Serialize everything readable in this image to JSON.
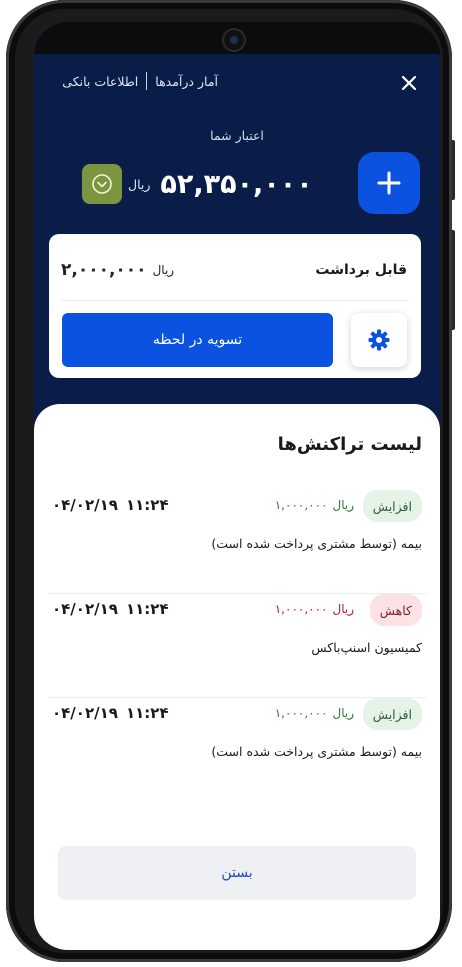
{
  "header": {
    "close_icon": "close-icon",
    "links": [
      "آمار درآمدها",
      "اطلاعات بانکی"
    ]
  },
  "balance": {
    "label": "اعتبار شما",
    "amount": "۵۲,۳۵۰,۰۰۰",
    "currency": "ریال"
  },
  "withdrawable": {
    "label": "قابل برداشت",
    "amount": "۲,۰۰۰,۰۰۰",
    "currency": "ریال",
    "settle_label": "تسویه در لحظه"
  },
  "transactions": {
    "title": "لیست تراکنش‌ها",
    "items": [
      {
        "type": "افزایش",
        "kind": "inc",
        "amount": "۱,۰۰۰,۰۰۰",
        "currency": "ریال",
        "time": "۱۱:۲۴",
        "date": "۰۴/۰۲/۱۹",
        "description": "بیمه (توسط مشتری پرداخت شده است)"
      },
      {
        "type": "کاهش",
        "kind": "dec",
        "amount": "۱,۰۰۰,۰۰۰",
        "currency": "ریال",
        "time": "۱۱:۲۴",
        "date": "۰۴/۰۲/۱۹",
        "description": "کمیسیون اسنپ‌باکس"
      },
      {
        "type": "افزایش",
        "kind": "inc",
        "amount": "۱,۰۰۰,۰۰۰",
        "currency": "ریال",
        "time": "۱۱:۲۴",
        "date": "۰۴/۰۲/۱۹",
        "description": "بیمه (توسط مشتری پرداخت شده است)"
      }
    ]
  },
  "footer": {
    "close_label": "بستن"
  },
  "colors": {
    "header_bg": "#0a1d48",
    "primary": "#0b52e0",
    "toggle": "#7e9540",
    "increase": "#2e7a45",
    "decrease": "#b31f2e"
  }
}
